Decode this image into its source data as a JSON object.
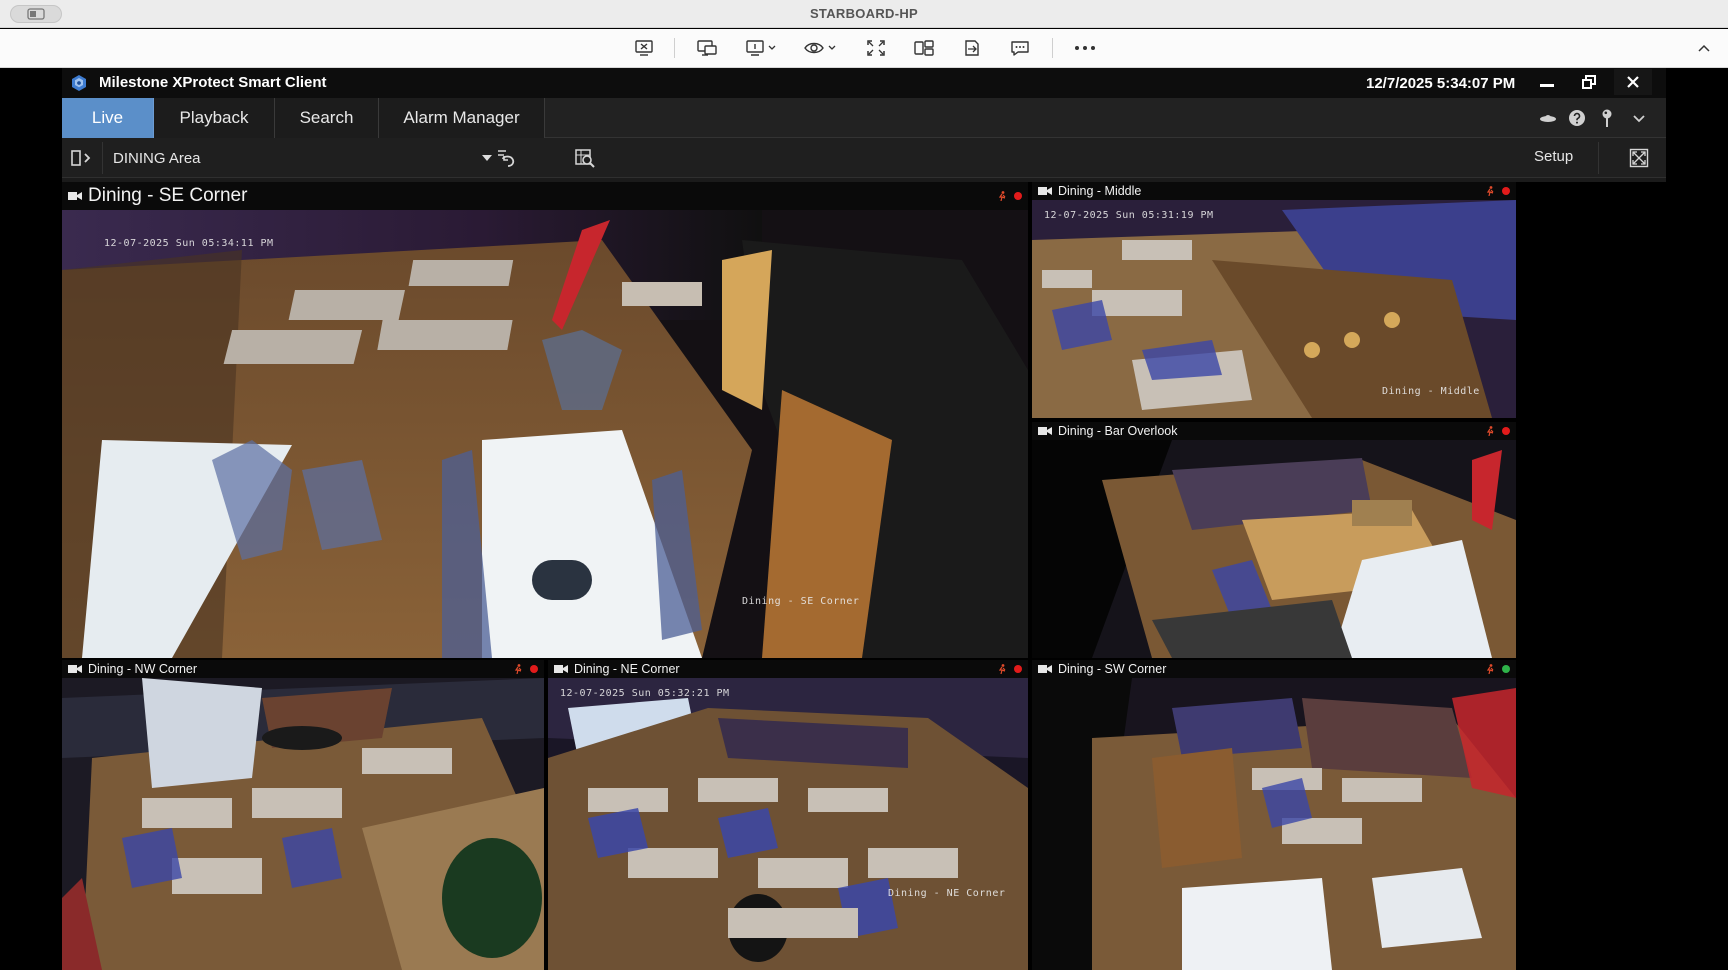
{
  "host": {
    "title": "STARBOARD-HP",
    "toolbar_icons": [
      "end-session-icon",
      "remote-display-icon",
      "display-select-icon",
      "view-mode-icon",
      "fullscreen-expand-icon",
      "multi-monitor-icon",
      "file-transfer-icon",
      "chat-icon",
      "more-icon"
    ]
  },
  "app": {
    "title": "Milestone XProtect Smart Client",
    "clock": "12/7/2025 5:34:07 PM",
    "tabs": [
      {
        "label": "Live",
        "active": true
      },
      {
        "label": "Playback",
        "active": false
      },
      {
        "label": "Search",
        "active": false
      },
      {
        "label": "Alarm Manager",
        "active": false
      }
    ],
    "view_selector": {
      "selected": "DINING Area"
    },
    "setup_label": "Setup",
    "accent_color": "#5b8fc9"
  },
  "cameras": [
    {
      "title": "Dining - SE Corner",
      "timestamp": "12-07-2025 Sun 05:34:11 PM",
      "overlay": "Dining - SE Corner",
      "recording": "red"
    },
    {
      "title": "Dining - Middle",
      "timestamp": "12-07-2025 Sun 05:31:19 PM",
      "overlay": "Dining - Middle",
      "recording": "red"
    },
    {
      "title": "Dining - Bar Overlook",
      "timestamp": "",
      "overlay": "",
      "recording": "red"
    },
    {
      "title": "Dining - NW Corner",
      "timestamp": "",
      "overlay": "",
      "recording": "red"
    },
    {
      "title": "Dining - NE Corner",
      "timestamp": "12-07-2025 Sun 05:32:21 PM",
      "overlay": "Dining - NE Corner",
      "recording": "red"
    },
    {
      "title": "Dining - SW Corner",
      "timestamp": "",
      "overlay": "",
      "recording": "green"
    }
  ]
}
